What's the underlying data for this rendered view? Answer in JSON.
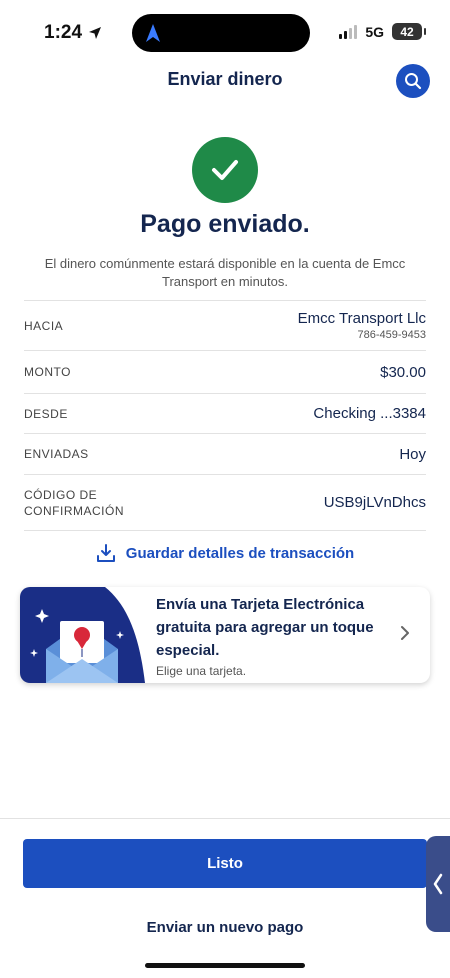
{
  "status_bar": {
    "time": "1:24",
    "network": "5G",
    "battery": "42"
  },
  "header": {
    "title": "Enviar dinero"
  },
  "success": {
    "headline": "Pago enviado.",
    "message": "El dinero comúnmente estará disponible en la cuenta de Emcc Transport en minutos."
  },
  "details": {
    "to_label": "HACIA",
    "to_name": "Emcc Transport Llc",
    "to_phone": "786-459-9453",
    "amount_label": "MONTO",
    "amount_value": "$30.00",
    "from_label": "DESDE",
    "from_value": "Checking ...3384",
    "sent_label": "ENVIADAS",
    "sent_value": "Hoy",
    "code_label": "CÓDIGO DE CONFIRMACIÓN",
    "code_value": "USB9jLVnDhcs"
  },
  "save_link": {
    "label": "Guardar detalles de transacción"
  },
  "promo": {
    "title": "Envía una Tarjeta Electrónica gratuita para agregar un toque especial.",
    "subtitle": "Elige una tarjeta."
  },
  "actions": {
    "done_label": "Listo",
    "new_payment_label": "Enviar un nuevo pago"
  },
  "colors": {
    "primary": "#1c4fbf",
    "navy": "#14264f",
    "success": "#1f8a48"
  }
}
